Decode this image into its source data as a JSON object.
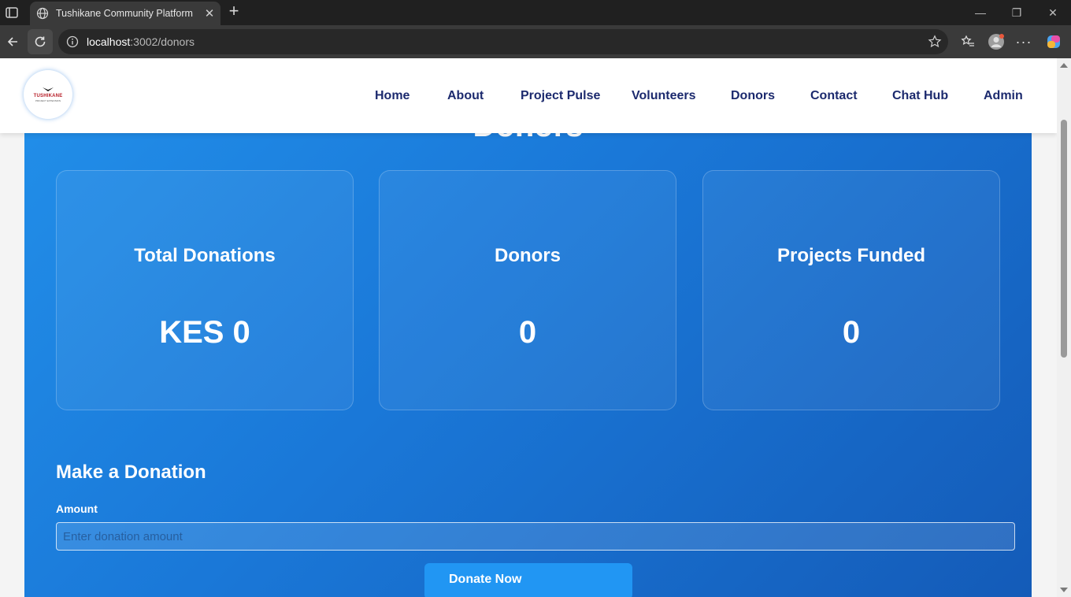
{
  "browser": {
    "tab_title": "Tushikane Community Platform",
    "url_host": "localhost",
    "url_path": ":3002/donors"
  },
  "navbar": {
    "logo_text": "TUSHIKANE",
    "logo_tagline": "PROJECT EXTENSION",
    "links": [
      "Home",
      "About",
      "Project Pulse",
      "Volunteers",
      "Donors",
      "Contact",
      "Chat Hub",
      "Admin"
    ]
  },
  "hero": {
    "title": "Donors"
  },
  "stats": [
    {
      "label": "Total Donations",
      "value": "KES 0"
    },
    {
      "label": "Donors",
      "value": "0"
    },
    {
      "label": "Projects Funded",
      "value": "0"
    }
  ],
  "donation_form": {
    "title": "Make a Donation",
    "amount_label": "Amount",
    "amount_placeholder": "Enter donation amount",
    "amount_value": "",
    "submit_label": "Donate Now"
  },
  "colors": {
    "hero_gradient_start": "#2290ea",
    "hero_gradient_end": "#145bb8",
    "nav_text": "#1c2a6e",
    "button": "#2196f3"
  }
}
